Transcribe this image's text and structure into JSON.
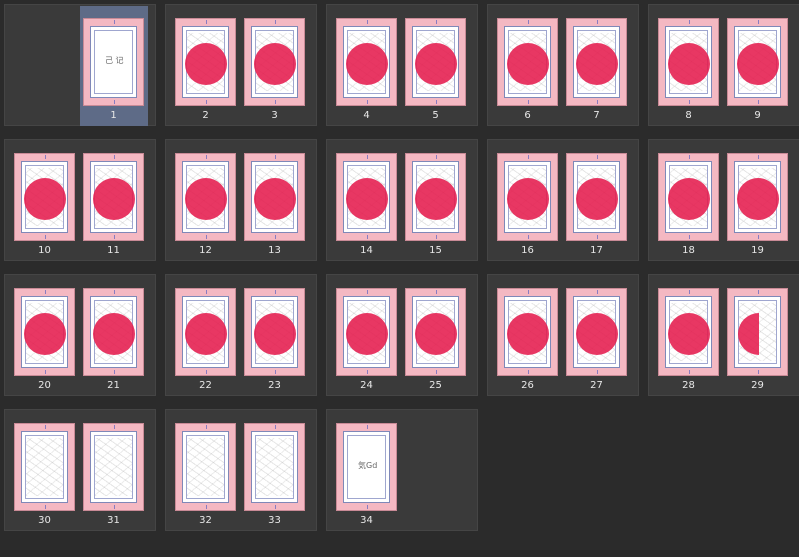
{
  "pages": [
    {
      "number": "1",
      "selected": true,
      "dot": "none",
      "sketch": false,
      "scrap_text": "己 记"
    },
    {
      "number": "2",
      "dot": "full",
      "sketch": true
    },
    {
      "number": "3",
      "dot": "full",
      "sketch": true
    },
    {
      "number": "4",
      "dot": "full",
      "sketch": true
    },
    {
      "number": "5",
      "dot": "full",
      "sketch": true
    },
    {
      "number": "6",
      "dot": "full",
      "sketch": true
    },
    {
      "number": "7",
      "dot": "full",
      "sketch": true
    },
    {
      "number": "8",
      "dot": "full",
      "sketch": true
    },
    {
      "number": "9",
      "dot": "full",
      "sketch": true
    },
    {
      "number": "10",
      "dot": "full",
      "sketch": true
    },
    {
      "number": "11",
      "dot": "full",
      "sketch": true
    },
    {
      "number": "12",
      "dot": "full",
      "sketch": true
    },
    {
      "number": "13",
      "dot": "full",
      "sketch": true
    },
    {
      "number": "14",
      "dot": "full",
      "sketch": true
    },
    {
      "number": "15",
      "dot": "full",
      "sketch": true
    },
    {
      "number": "16",
      "dot": "full",
      "sketch": true
    },
    {
      "number": "17",
      "dot": "full",
      "sketch": true
    },
    {
      "number": "18",
      "dot": "full",
      "sketch": true
    },
    {
      "number": "19",
      "dot": "full",
      "sketch": true
    },
    {
      "number": "20",
      "dot": "full",
      "sketch": true
    },
    {
      "number": "21",
      "dot": "full",
      "sketch": true
    },
    {
      "number": "22",
      "dot": "full",
      "sketch": true
    },
    {
      "number": "23",
      "dot": "full",
      "sketch": true
    },
    {
      "number": "24",
      "dot": "full",
      "sketch": true
    },
    {
      "number": "25",
      "dot": "full",
      "sketch": true
    },
    {
      "number": "26",
      "dot": "full",
      "sketch": true
    },
    {
      "number": "27",
      "dot": "full",
      "sketch": true
    },
    {
      "number": "28",
      "dot": "full",
      "sketch": true
    },
    {
      "number": "29",
      "dot": "half",
      "sketch": true
    },
    {
      "number": "30",
      "dot": "none",
      "sketch": true
    },
    {
      "number": "31",
      "dot": "none",
      "sketch": true
    },
    {
      "number": "32",
      "dot": "none",
      "sketch": true
    },
    {
      "number": "33",
      "dot": "none",
      "sketch": true
    },
    {
      "number": "34",
      "dot": "none",
      "sketch": false,
      "scrap_text": "気Gd"
    }
  ],
  "colors": {
    "background": "#2b2b2b",
    "spread": "#3a3a3a",
    "page_frame": "#f4b8c2",
    "dot": "#e51b4d",
    "selection": "#5e6b87",
    "label": "#e8e8e8"
  }
}
